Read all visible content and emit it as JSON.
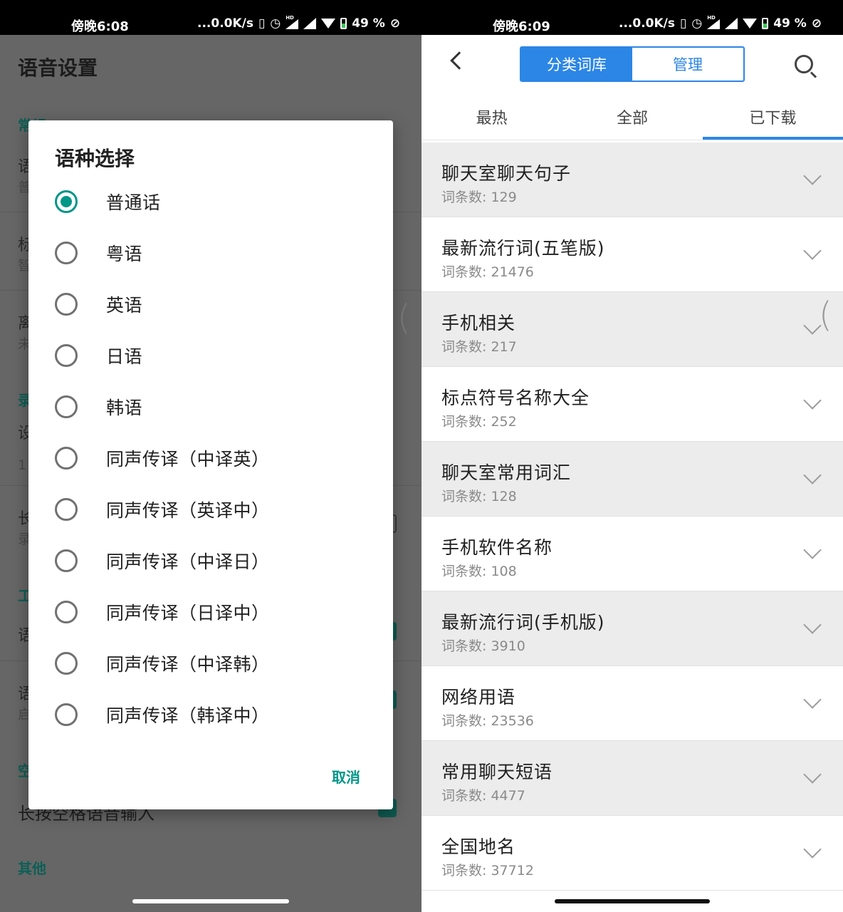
{
  "left": {
    "status": {
      "time": "傍晚6:08",
      "speed": "...0.0K/s",
      "battery": "49 %"
    },
    "page_title": "语音设置",
    "background": {
      "section_common": "常规",
      "hint_1": "语",
      "hint_1b": "普",
      "hint_2": "标",
      "hint_2b": "智",
      "hint_3": "离",
      "hint_3b": "未",
      "section_record": "录",
      "hint_4": "设",
      "hint_4b": "1",
      "hint_5": "长",
      "hint_5b": "录",
      "section_tool": "工",
      "hint_6": "语",
      "hint_7": "语",
      "hint_7b": "启",
      "section_space": "空",
      "bottom_item": "长按空格语音输入",
      "section_other": "其他"
    },
    "dialog": {
      "title": "语种选择",
      "options": [
        "普通话",
        "粤语",
        "英语",
        "日语",
        "韩语",
        "同声传译（中译英）",
        "同声传译（英译中）",
        "同声传译（中译日）",
        "同声传译（日译中）",
        "同声传译（中译韩）",
        "同声传译（韩译中）"
      ],
      "selected_index": 0,
      "cancel": "取消"
    }
  },
  "right": {
    "status": {
      "time": "傍晚6:09",
      "speed": "...0.0K/s",
      "battery": "49 %"
    },
    "segment": {
      "active": "分类词库",
      "inactive": "管理"
    },
    "tabs": [
      "最热",
      "全部",
      "已下载"
    ],
    "active_tab": 2,
    "count_prefix": "词条数: ",
    "items": [
      {
        "title": "聊天室聊天句子",
        "count": "129"
      },
      {
        "title": "最新流行词(五笔版)",
        "count": "21476"
      },
      {
        "title": "手机相关",
        "count": "217"
      },
      {
        "title": "标点符号名称大全",
        "count": "252"
      },
      {
        "title": "聊天室常用词汇",
        "count": "128"
      },
      {
        "title": "手机软件名称",
        "count": "108"
      },
      {
        "title": "最新流行词(手机版)",
        "count": "3910"
      },
      {
        "title": "网络用语",
        "count": "23536"
      },
      {
        "title": "常用聊天短语",
        "count": "4477"
      },
      {
        "title": "全国地名",
        "count": "37712"
      }
    ]
  },
  "colors": {
    "accent_teal": "#009688",
    "accent_blue": "#2c86e5"
  }
}
